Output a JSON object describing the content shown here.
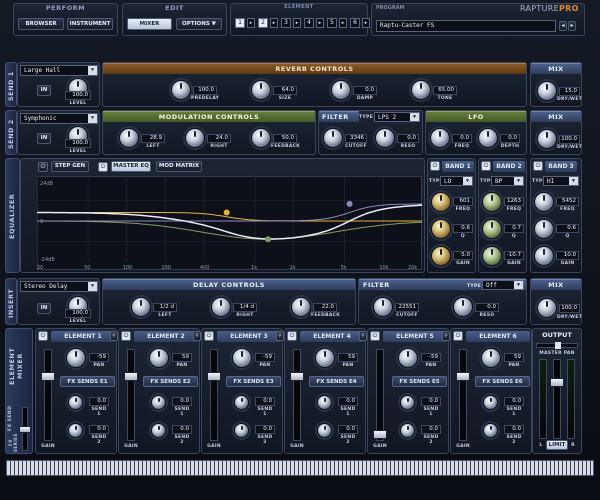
{
  "top": {
    "perform_label": "PERFORM",
    "browser": "BROWSER",
    "instrument": "INSTRUMENT",
    "edit_label": "EDIT",
    "mixer": "MIXER",
    "options": "OPTIONS ▼",
    "element_label": "ELEMENT",
    "element_buttons": [
      "1",
      "2",
      "3",
      "4",
      "5",
      "6"
    ],
    "program_label": "PROGRAM",
    "program_name": "Raptu-Caster FS",
    "brand": "RAPTURE",
    "brand_pro": "PRO"
  },
  "send1": {
    "side": "SEND 1",
    "preset": "Large Hall",
    "in": "IN",
    "level_val": "100.0",
    "level_lbl": "LEVEL",
    "header": "REVERB CONTROLS",
    "knobs": [
      {
        "val": "100.0",
        "lbl": "PREDELAY"
      },
      {
        "val": "64.0",
        "lbl": "SIZE"
      },
      {
        "val": "0.0",
        "lbl": "DAMP"
      },
      {
        "val": "65.00",
        "lbl": "TONE"
      }
    ],
    "mix_header": "MIX",
    "mix_val": "15.0",
    "mix_lbl": "DRY/WET"
  },
  "send2": {
    "side": "SEND 2",
    "preset": "Symphonic",
    "in": "IN",
    "level_val": "100.0",
    "level_lbl": "LEVEL",
    "mod_header": "MODULATION CONTROLS",
    "mod_knobs": [
      {
        "val": "28.9",
        "lbl": "LEFT"
      },
      {
        "val": "24.0",
        "lbl": "RIGHT"
      },
      {
        "val": "50.0",
        "lbl": "FEEDBACK"
      }
    ],
    "filter_header": "FILTER",
    "filter_type_lbl": "TYPE",
    "filter_type": "LPS 2",
    "filter_knobs": [
      {
        "val": "3346",
        "lbl": "CUTOFF"
      },
      {
        "val": "0.0",
        "lbl": "RESO"
      }
    ],
    "lfo_header": "LFO",
    "lfo_knobs": [
      {
        "val": "0.0",
        "lbl": "FREQ"
      },
      {
        "val": "0.0",
        "lbl": "DEPTH"
      }
    ],
    "mix_header": "MIX",
    "mix_val": "100.0",
    "mix_lbl": "DRY/WET"
  },
  "eq": {
    "side": "EQUALIZER",
    "step_gen": "STEP GEN",
    "master_eq": "MASTER EQ",
    "mod_matrix": "MOD MATRIX",
    "db_labels": [
      "24dB",
      "0",
      "-24dB"
    ],
    "freq_labels": [
      "20",
      "50",
      "100",
      "200",
      "400",
      "1k",
      "2k",
      "5k",
      "10k",
      "20k"
    ],
    "bands": [
      {
        "name": "BAND 1",
        "type_lbl": "TYPE",
        "type": "LO",
        "knobs": [
          {
            "val": "601",
            "lbl": "FREQ"
          },
          {
            "val": "0.6",
            "lbl": "Q"
          },
          {
            "val": "5.0",
            "lbl": "GAIN"
          }
        ]
      },
      {
        "name": "BAND 2",
        "type_lbl": "TYPE",
        "type": "BP",
        "knobs": [
          {
            "val": "1263",
            "lbl": "FREQ"
          },
          {
            "val": "0.7",
            "lbl": "Q"
          },
          {
            "val": "-10.7",
            "lbl": "GAIN"
          }
        ]
      },
      {
        "name": "BAND 3",
        "type_lbl": "TYPE",
        "type": "HI",
        "knobs": [
          {
            "val": "5452",
            "lbl": "FREQ"
          },
          {
            "val": "0.6",
            "lbl": "Q"
          },
          {
            "val": "10.0",
            "lbl": "GAIN"
          }
        ]
      }
    ],
    "colors": {
      "curve": "#e8ecf4",
      "band1": "#e8b53a",
      "band2": "#7fa25a",
      "band3": "#8f87c4"
    }
  },
  "insert": {
    "side": "INSERT",
    "preset": "Stereo Delay",
    "in": "IN",
    "level_val": "100.0",
    "level_lbl": "LEVEL",
    "header": "DELAY CONTROLS",
    "knobs": [
      {
        "val": "1/2 d",
        "lbl": "LEFT"
      },
      {
        "val": "1/4 d",
        "lbl": "RIGHT"
      },
      {
        "val": "22.0",
        "lbl": "FEEDBACK"
      }
    ],
    "filter_header": "FILTER",
    "filter_type_lbl": "TYPE",
    "filter_type": "Off",
    "filter_knobs": [
      {
        "val": "22551",
        "lbl": "CUTOFF"
      },
      {
        "val": "0.0",
        "lbl": "RESO"
      }
    ],
    "mix_header": "MIX",
    "mix_val": "100.0",
    "mix_lbl": "DRY/WET"
  },
  "mixer": {
    "side": "ELEMENT MIXER",
    "fx_send_lbl": "FX SEND",
    "fx_series_lbl": "FX SERIES",
    "elements": [
      {
        "name": "ELEMENT 1",
        "pan": "-59",
        "sends": "FX SENDS E1",
        "s1": "0.0",
        "s2": "0.0"
      },
      {
        "name": "ELEMENT 2",
        "pan": "59",
        "sends": "FX SENDS E2",
        "s1": "0.0",
        "s2": "0.0"
      },
      {
        "name": "ELEMENT 3",
        "pan": "-59",
        "sends": "FX SENDS E3",
        "s1": "0.0",
        "s2": "0.0"
      },
      {
        "name": "ELEMENT 4",
        "pan": "59",
        "sends": "FX SENDS E4",
        "s1": "0.0",
        "s2": "0.0"
      },
      {
        "name": "ELEMENT 5",
        "pan": "-59",
        "sends": "FX SENDS E5",
        "s1": "0.0",
        "s2": "0.0"
      },
      {
        "name": "ELEMENT 6",
        "pan": "59",
        "sends": "FX SENDS E6",
        "s1": "0.0",
        "s2": "0.0"
      }
    ],
    "pan_lbl": "PAN",
    "send1_lbl": "SEND 1",
    "send2_lbl": "SEND 2",
    "gain_lbl": "GAIN",
    "output": "OUTPUT",
    "master_pan": "MASTER PAN",
    "limit": "LIMIT",
    "l": "L",
    "r": "R"
  }
}
